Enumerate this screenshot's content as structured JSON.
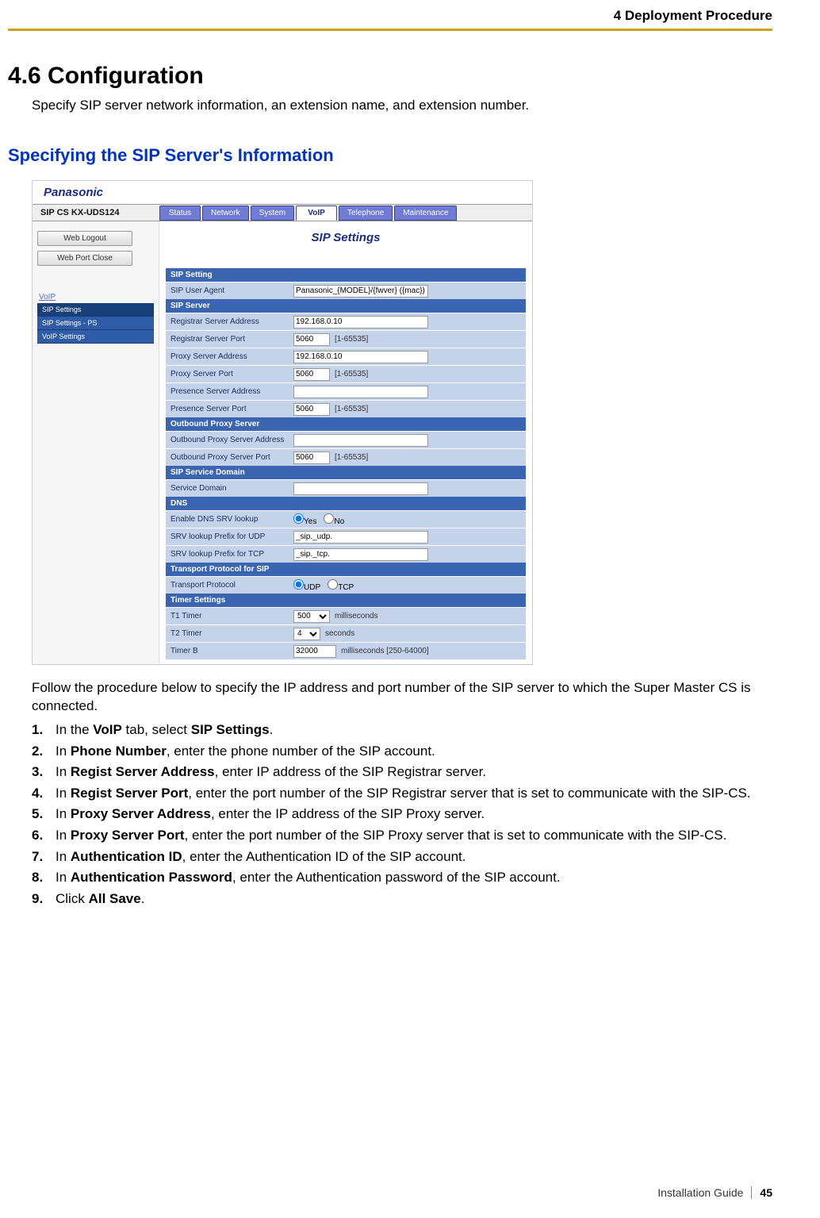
{
  "header": {
    "chapter": "4 Deployment Procedure"
  },
  "section": {
    "number_title": "4.6  Configuration",
    "intro": "Specify SIP server network information, an extension name, and extension number.",
    "subheading": "Specifying the SIP Server's Information"
  },
  "screenshot": {
    "brand": "Panasonic",
    "device": "SIP CS KX-UDS124",
    "tabs": [
      "Status",
      "Network",
      "System",
      "VoIP",
      "Telephone",
      "Maintenance"
    ],
    "active_tab_index": 3,
    "side_buttons": [
      "Web Logout",
      "Web Port Close"
    ],
    "side_group_title": "VoIP",
    "side_items": [
      "SIP Settings",
      "SIP Settings - PS",
      "VoIP Settings"
    ],
    "main_title": "SIP Settings",
    "groups": {
      "sip_setting": {
        "header": "SIP Setting",
        "user_agent_label": "SIP User Agent",
        "user_agent_value": "Panasonic_{MODEL}/{fwver} ({mac})"
      },
      "sip_server": {
        "header": "SIP Server",
        "registrar_addr_label": "Registrar Server Address",
        "registrar_addr_value": "192.168.0.10",
        "registrar_port_label": "Registrar Server Port",
        "registrar_port_value": "5060",
        "proxy_addr_label": "Proxy Server Address",
        "proxy_addr_value": "192.168.0.10",
        "proxy_port_label": "Proxy Server Port",
        "proxy_port_value": "5060",
        "presence_addr_label": "Presence Server Address",
        "presence_addr_value": "",
        "presence_port_label": "Presence Server Port",
        "presence_port_value": "5060",
        "port_range_hint": "[1-65535]"
      },
      "outbound": {
        "header": "Outbound Proxy Server",
        "addr_label": "Outbound Proxy Server Address",
        "addr_value": "",
        "port_label": "Outbound Proxy Server Port",
        "port_value": "5060",
        "port_hint": "[1-65535]"
      },
      "domain": {
        "header": "SIP Service Domain",
        "label": "Service Domain",
        "value": ""
      },
      "dns": {
        "header": "DNS",
        "srv_label": "Enable DNS SRV lookup",
        "srv_yes": "Yes",
        "srv_no": "No",
        "udp_prefix_label": "SRV lookup Prefix for UDP",
        "udp_prefix_value": "_sip._udp.",
        "tcp_prefix_label": "SRV lookup Prefix for TCP",
        "tcp_prefix_value": "_sip._tcp."
      },
      "transport": {
        "header": "Transport Protocol for SIP",
        "label": "Transport Protocol",
        "opt_udp": "UDP",
        "opt_tcp": "TCP"
      },
      "timer": {
        "header": "Timer Settings",
        "t1_label": "T1 Timer",
        "t1_value": "500",
        "t1_unit": "milliseconds",
        "t2_label": "T2 Timer",
        "t2_value": "4",
        "t2_unit": "seconds",
        "tb_label": "Timer B",
        "tb_value": "32000",
        "tb_unit": "milliseconds [250-64000]"
      }
    }
  },
  "instruction_lead": "Follow the procedure below to specify the IP address and port number of the SIP server to which the Super Master CS is connected.",
  "steps": [
    {
      "n": "1.",
      "html": "In the <b>VoIP</b> tab, select <b>SIP Settings</b>."
    },
    {
      "n": "2.",
      "html": "In <b>Phone Number</b>, enter the phone number of the SIP account."
    },
    {
      "n": "3.",
      "html": "In <b>Regist Server Address</b>, enter IP address of the SIP Registrar server."
    },
    {
      "n": "4.",
      "html": "In <b>Regist Server Port</b>, enter the port number of the SIP Registrar server that is set to communicate with the SIP-CS."
    },
    {
      "n": "5.",
      "html": "In <b>Proxy Server Address</b>, enter the IP address of the SIP Proxy server."
    },
    {
      "n": "6.",
      "html": "In <b>Proxy Server Port</b>, enter the port number of the SIP Proxy server that is set to communicate with the SIP-CS."
    },
    {
      "n": "7.",
      "html": "In <b>Authentication ID</b>, enter the Authentication ID of the SIP account."
    },
    {
      "n": "8.",
      "html": "In <b>Authentication Password</b>, enter the Authentication password of the SIP account."
    },
    {
      "n": "9.",
      "html": "Click <b>All Save</b>."
    }
  ],
  "footer": {
    "doc": "Installation Guide",
    "page": "45"
  }
}
